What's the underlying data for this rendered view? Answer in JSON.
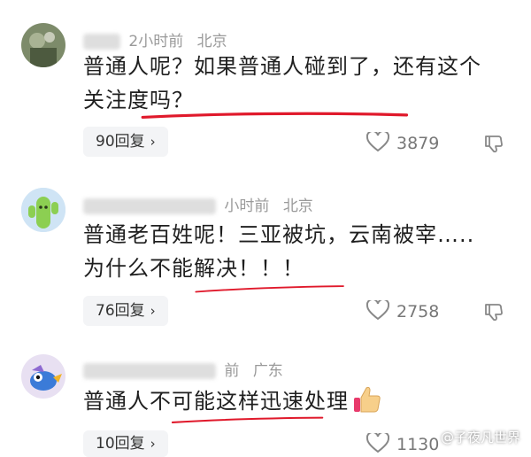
{
  "comments": [
    {
      "time": "2小时前",
      "location": "北京",
      "text_lines": [
        "普通人呢？如果普通人碰到了，还有这个",
        "关注度吗？"
      ],
      "reply_label": "90回复",
      "chevron": "›",
      "likes": "3879"
    },
    {
      "time": "小时前",
      "location": "北京",
      "text_lines": [
        "普通老百姓呢！三亚被坑，云南被宰…..",
        "为什么不能解决！！！"
      ],
      "reply_label": "76回复",
      "chevron": "›",
      "likes": "2758"
    },
    {
      "time": "前",
      "location": "广东",
      "text_lines": [
        "普通人不可能这样迅速处理"
      ],
      "reply_label": "10回复",
      "chevron": "›",
      "likes": "1130"
    }
  ],
  "watermark": "@子夜凡世界",
  "colors": {
    "underline": "#e0192b",
    "muted": "#9a9a9a",
    "pill": "#f3f4f6"
  },
  "icons": [
    "avatar-photo",
    "cactus-avatar",
    "bird-avatar",
    "heart-outline-icon",
    "thumbs-down-icon",
    "thumbs-up-emoji"
  ]
}
